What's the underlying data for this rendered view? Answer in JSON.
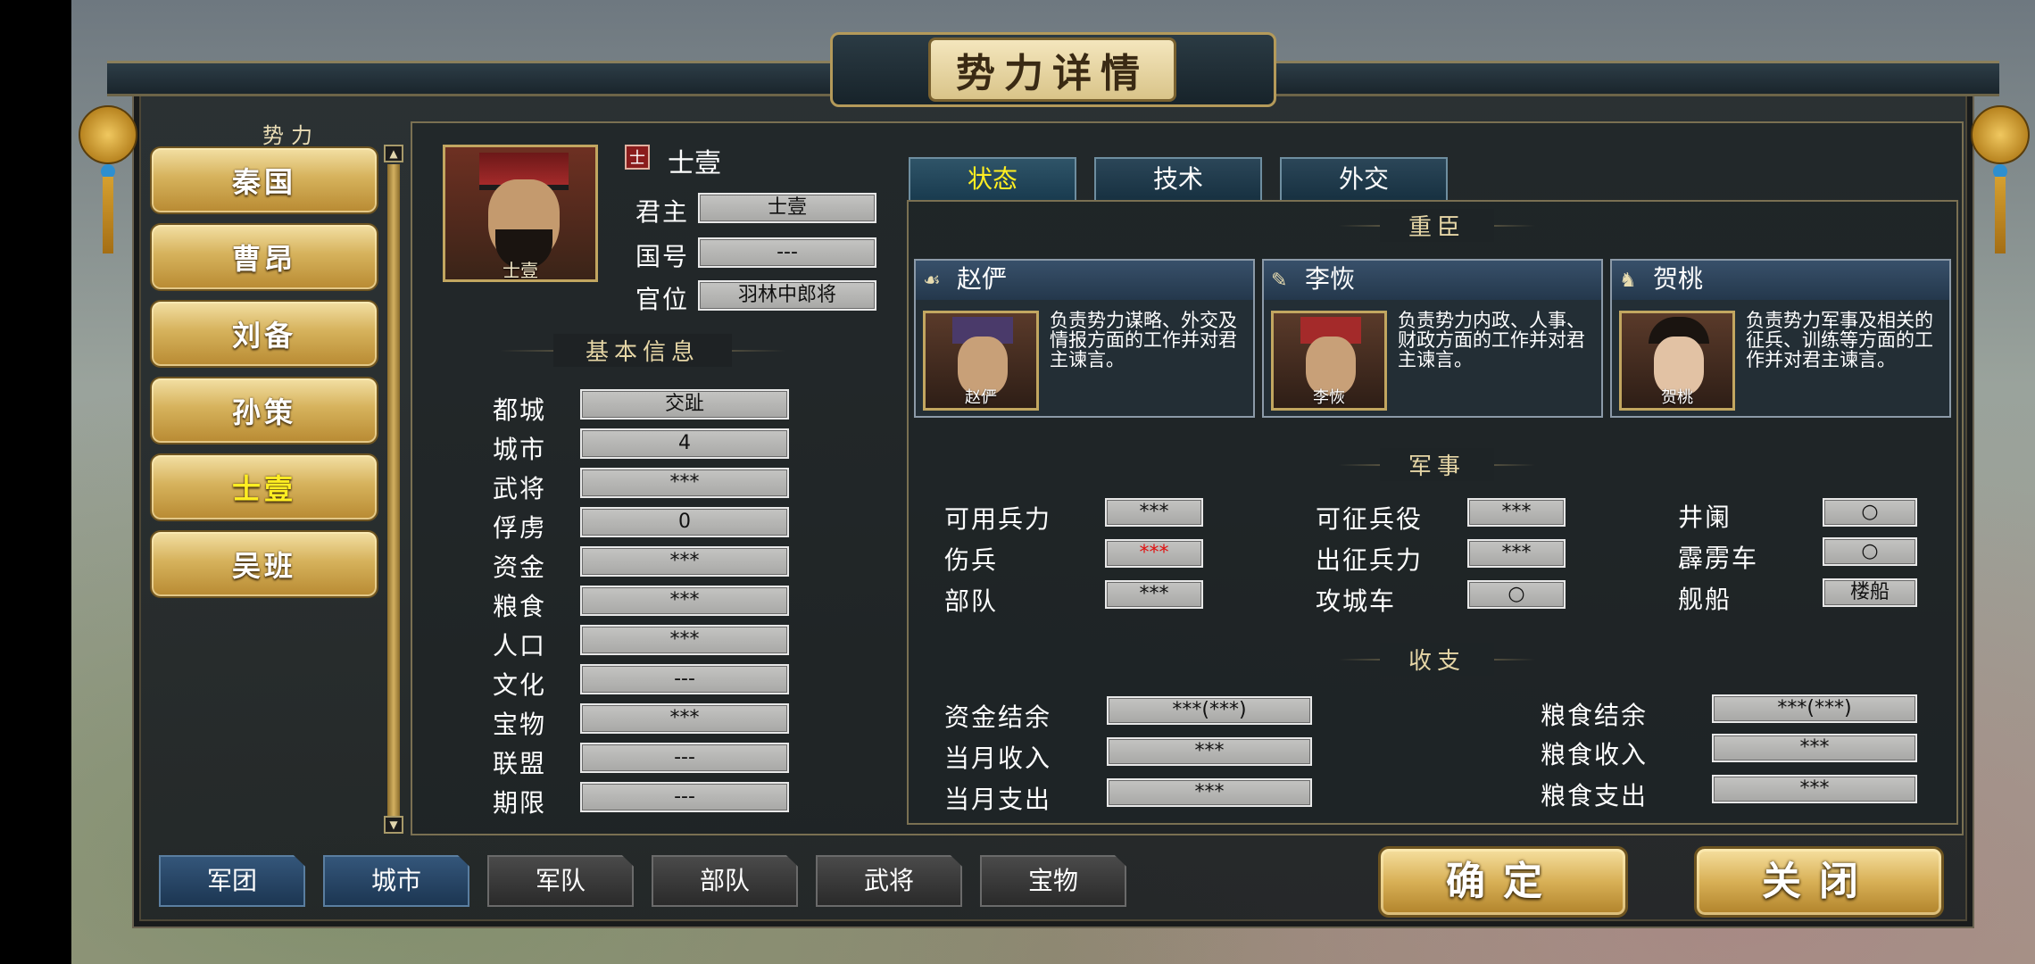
{
  "title": "势力详情",
  "factions": {
    "header": "势力",
    "items": [
      {
        "label": "秦国",
        "selected": false
      },
      {
        "label": "曹昂",
        "selected": false
      },
      {
        "label": "刘备",
        "selected": false
      },
      {
        "label": "孙策",
        "selected": false
      },
      {
        "label": "士壹",
        "selected": true
      },
      {
        "label": "吴班",
        "selected": false
      }
    ]
  },
  "ruler": {
    "flag": "士",
    "name": "士壹",
    "portrait_name": "士壹",
    "fields": [
      {
        "label": "君主",
        "value": "士壹"
      },
      {
        "label": "国号",
        "value": "---"
      },
      {
        "label": "官位",
        "value": "羽林中郎将"
      }
    ]
  },
  "basic_info": {
    "title": "基本信息",
    "rows": [
      {
        "label": "都城",
        "value": "交趾"
      },
      {
        "label": "城市",
        "value": "4"
      },
      {
        "label": "武将",
        "value": "***"
      },
      {
        "label": "俘虏",
        "value": "0"
      },
      {
        "label": "资金",
        "value": "***"
      },
      {
        "label": "粮食",
        "value": "***"
      },
      {
        "label": "人口",
        "value": "***"
      },
      {
        "label": "文化",
        "value": "---"
      },
      {
        "label": "宝物",
        "value": "***"
      },
      {
        "label": "联盟",
        "value": "---"
      },
      {
        "label": "期限",
        "value": "---"
      }
    ]
  },
  "tabs": [
    {
      "label": "状态",
      "active": true
    },
    {
      "label": "技术",
      "active": false
    },
    {
      "label": "外交",
      "active": false
    }
  ],
  "ministers": {
    "title": "重臣",
    "items": [
      {
        "name": "赵俨",
        "icon": "☙",
        "desc": "负责势力谋略、外交及情报方面的工作并对君主谏言。"
      },
      {
        "name": "李恢",
        "icon": "✎",
        "desc": "负责势力内政、人事、财政方面的工作并对君主谏言。"
      },
      {
        "name": "贺桃",
        "icon": "♞",
        "desc": "负责势力军事及相关的征兵、训练等方面的工作并对君主谏言。"
      }
    ]
  },
  "military": {
    "title": "军事",
    "col1": [
      {
        "label": "可用兵力",
        "value": "***",
        "red": false
      },
      {
        "label": "伤兵",
        "value": "***",
        "red": true
      },
      {
        "label": "部队",
        "value": "***",
        "red": false
      }
    ],
    "col2": [
      {
        "label": "可征兵役",
        "value": "***"
      },
      {
        "label": "出征兵力",
        "value": "***"
      },
      {
        "label": "攻城车",
        "value": "○"
      }
    ],
    "col3": [
      {
        "label": "井阑",
        "value": "○"
      },
      {
        "label": "霹雳车",
        "value": "○"
      },
      {
        "label": "舰船",
        "value": "楼船"
      }
    ]
  },
  "finance": {
    "title": "收支",
    "left": [
      {
        "label": "资金结余",
        "value": "***(***)"
      },
      {
        "label": "当月收入",
        "value": "***"
      },
      {
        "label": "当月支出",
        "value": "***"
      }
    ],
    "right": [
      {
        "label": "粮食结余",
        "value": "***(***)"
      },
      {
        "label": "粮食收入",
        "value": "***"
      },
      {
        "label": "粮食支出",
        "value": "***"
      }
    ]
  },
  "bottom_tabs": [
    {
      "label": "军团",
      "style": "blue"
    },
    {
      "label": "城市",
      "style": "blue"
    },
    {
      "label": "军队",
      "style": "gray"
    },
    {
      "label": "部队",
      "style": "gray"
    },
    {
      "label": "武将",
      "style": "gray"
    },
    {
      "label": "宝物",
      "style": "gray"
    }
  ],
  "actions": {
    "confirm": "确定",
    "close": "关闭"
  },
  "colors": {
    "selected_text": "#ffee22",
    "gold": "#d6b25c",
    "warning": "#e01010"
  }
}
